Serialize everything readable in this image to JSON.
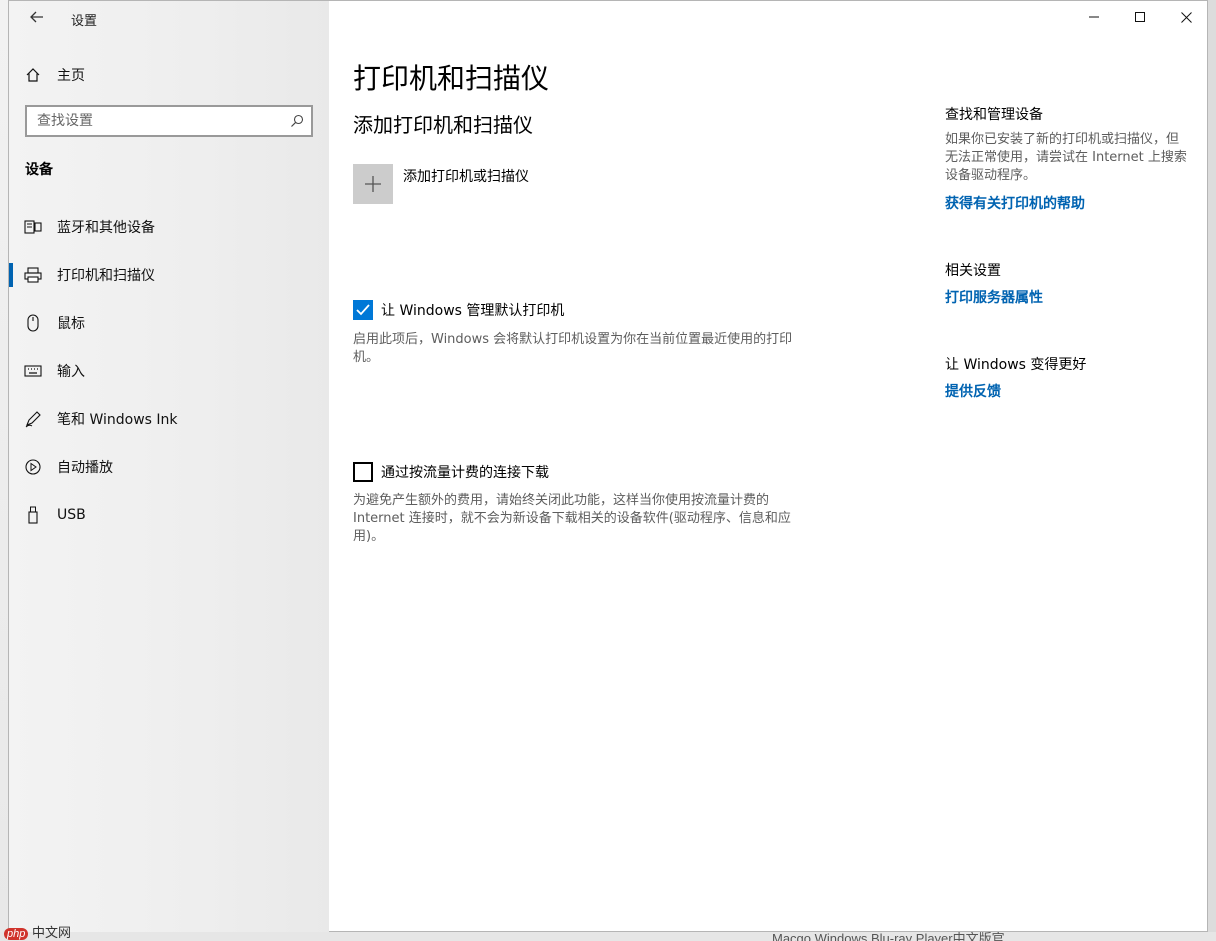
{
  "window": {
    "title": "设置",
    "back_icon": "back-arrow-icon"
  },
  "sidebar": {
    "home_label": "主页",
    "search_placeholder": "查找设置",
    "section_heading": "设备",
    "items": [
      {
        "label": "蓝牙和其他设备",
        "icon": "bluetooth-devices-icon",
        "active": false
      },
      {
        "label": "打印机和扫描仪",
        "icon": "printer-icon",
        "active": true
      },
      {
        "label": "鼠标",
        "icon": "mouse-icon",
        "active": false
      },
      {
        "label": "输入",
        "icon": "keyboard-icon",
        "active": false
      },
      {
        "label": "笔和 Windows Ink",
        "icon": "pen-icon",
        "active": false
      },
      {
        "label": "自动播放",
        "icon": "autoplay-icon",
        "active": false
      },
      {
        "label": "USB",
        "icon": "usb-icon",
        "active": false
      }
    ]
  },
  "main": {
    "page_title": "打印机和扫描仪",
    "add_section_title": "添加打印机和扫描仪",
    "add_button_label": "添加打印机或扫描仪",
    "default_printer": {
      "label": "让 Windows 管理默认打印机",
      "checked": true,
      "description": "启用此项后，Windows 会将默认打印机设置为你在当前位置最近使用的打印机。"
    },
    "metered": {
      "label": "通过按流量计费的连接下载",
      "checked": false,
      "description": "为避免产生额外的费用，请始终关闭此功能，这样当你使用按流量计费的 Internet 连接时，就不会为新设备下载相关的设备软件(驱动程序、信息和应用)。"
    }
  },
  "right_panel": {
    "find_heading": "查找和管理设备",
    "find_text": "如果你已安装了新的打印机或扫描仪，但无法正常使用，请尝试在 Internet 上搜索设备驱动程序。",
    "find_link": "获得有关打印机的帮助",
    "related_heading": "相关设置",
    "related_link": "打印服务器属性",
    "better_heading": "让 Windows 变得更好",
    "better_link": "提供反馈"
  },
  "background": {
    "bottom_text": "Macgo Windows Blu-ray Player中文版官...",
    "watermark": "中文网",
    "watermark_badge": "php"
  },
  "colors": {
    "accent": "#0078d7",
    "link": "#0063b1"
  }
}
